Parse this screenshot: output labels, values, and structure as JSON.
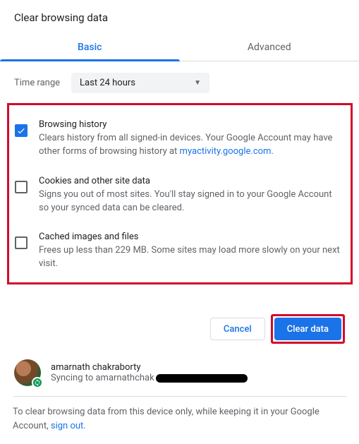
{
  "title": "Clear browsing data",
  "tabs": {
    "basic": "Basic",
    "advanced": "Advanced"
  },
  "time": {
    "label": "Time range",
    "selected": "Last 24 hours"
  },
  "options": {
    "history": {
      "title": "Browsing history",
      "desc_before": "Clears history from all signed-in devices. Your Google Account may have other forms of browsing history at ",
      "link": "myactivity.google.com",
      "desc_after": "."
    },
    "cookies": {
      "title": "Cookies and other site data",
      "desc": "Signs you out of most sites. You'll stay signed in to your Google Account so your synced data can be cleared."
    },
    "cache": {
      "title": "Cached images and files",
      "desc": "Frees up less than 229 MB. Some sites may load more slowly on your next visit."
    }
  },
  "actions": {
    "cancel": "Cancel",
    "clear": "Clear data"
  },
  "account": {
    "name": "amarnath chakraborty",
    "sync_prefix": "Syncing to amarnathchak"
  },
  "footer": {
    "text_before": "To clear browsing data from this device only, while keeping it in your Google Account, ",
    "link": "sign out",
    "text_after": "."
  }
}
